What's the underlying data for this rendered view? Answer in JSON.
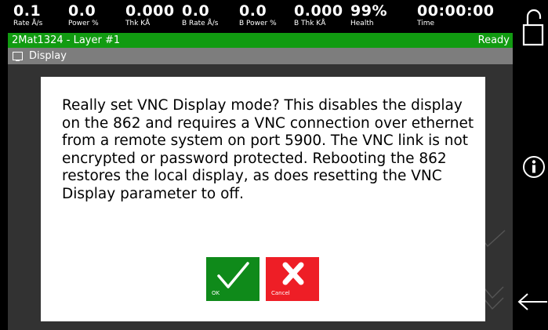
{
  "metrics": [
    {
      "value": "0.1",
      "label": "Rate Å/s"
    },
    {
      "value": "0.0",
      "label": "Power %"
    },
    {
      "value": "0.000",
      "label": "Thk KÅ"
    },
    {
      "value": "0.0",
      "label": "B Rate Å/s"
    },
    {
      "value": "0.0",
      "label": "B Power %"
    },
    {
      "value": "0.000",
      "label": "B Thk KÅ"
    },
    {
      "value": "99%",
      "label": "Health"
    },
    {
      "value": "00:00:00",
      "label": "Time"
    }
  ],
  "status": {
    "process": "2Mat1324 - Layer #1",
    "state": "Ready",
    "color": "#119b11"
  },
  "breadcrumb": {
    "label": "Display"
  },
  "dialog": {
    "message": "Really set VNC Display mode?  This disables the display on the 862 and requires a VNC connection over ethernet from a remote system on port 5900.  The VNC link is not encrypted or password protected. Rebooting the 862 restores the local display, as does resetting the VNC Display parameter to off.",
    "ok_label": "OK",
    "cancel_label": "Cancel",
    "ok_color": "#0f8a1a",
    "cancel_color": "#ee1e26"
  },
  "sidebar": {
    "icons": [
      "lock-icon",
      "info-icon",
      "back-arrow-icon"
    ]
  }
}
